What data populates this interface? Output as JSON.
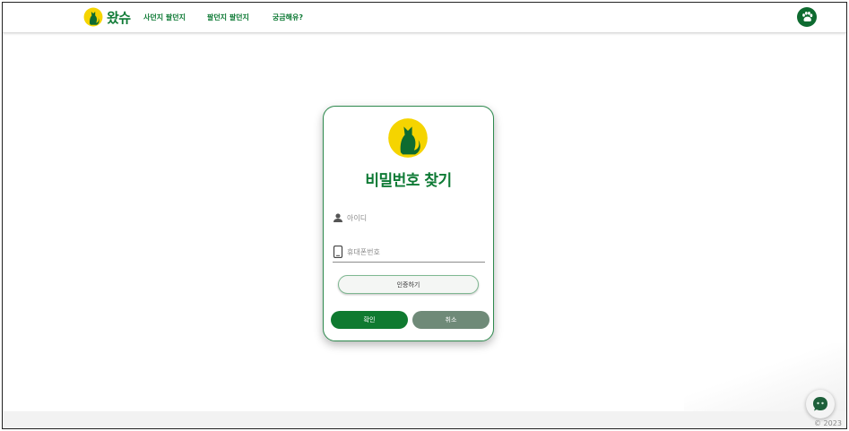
{
  "header": {
    "brand_name": "왔슈",
    "nav": [
      "사던지 팔던지",
      "팔던지 팔던지",
      "궁금해유?"
    ]
  },
  "card": {
    "title": "비밀번호 찾기",
    "id_placeholder": "아이디",
    "phone_placeholder": "휴대폰번호",
    "verify_label": "인증하기",
    "confirm_label": "확인",
    "cancel_label": "취소"
  },
  "footer": {
    "copyright": "© 2023"
  },
  "colors": {
    "brand_green": "#0e7a35",
    "logo_yellow": "#f5d400",
    "cancel_gray": "#6f8a78"
  },
  "icons": {
    "brand": "cat-logo-icon",
    "menu": "paw-icon",
    "id_field": "user-icon",
    "phone_field": "phone-icon",
    "chat": "chat-bubble-icon"
  }
}
